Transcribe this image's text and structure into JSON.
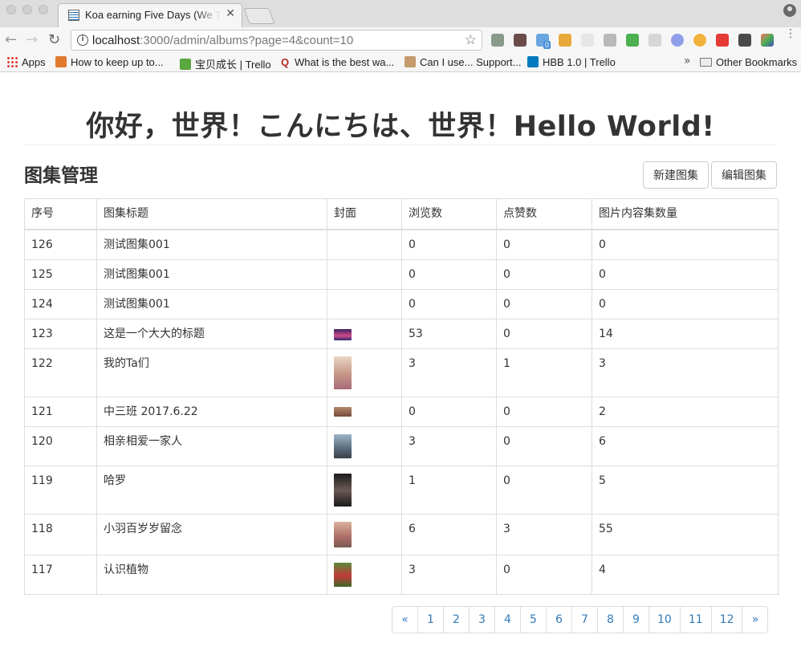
{
  "browser": {
    "tab_title": "Koa earning Five Days (We The",
    "close_glyph": "✕",
    "url_host": "localhost",
    "url_rest": ":3000/admin/albums?page=4&count=10",
    "info_glyph": "i",
    "star_glyph": "☆",
    "back_glyph": "←",
    "forward_glyph": "→",
    "reload_glyph": "↻",
    "menu_glyph": "⋮",
    "overflow_glyph": "»",
    "bookmarks": [
      {
        "label": "Apps",
        "icon": "apps-grid-icon"
      },
      {
        "label": "How to keep up to...",
        "icon": "bookmark-favicon-icon"
      },
      {
        "label": "宝贝成长 | Trello",
        "icon": "trello-board-icon"
      },
      {
        "label": "What is the best wa...",
        "icon": "quora-icon"
      },
      {
        "label": "Can I use... Support...",
        "icon": "caniuse-icon"
      },
      {
        "label": "HBB 1.0 | Trello",
        "icon": "trello-icon"
      }
    ],
    "other_bookmarks": "Other Bookmarks",
    "extension_badge": "0"
  },
  "page": {
    "hero_title": "你好，世界！こんにちは、世界！Hello World!",
    "section_title": "图集管理",
    "new_button": "新建图集",
    "edit_button": "编辑图集"
  },
  "table": {
    "columns": [
      "序号",
      "图集标题",
      "封面",
      "浏览数",
      "点赞数",
      "图片内容集数量"
    ],
    "rows": [
      {
        "id": "126",
        "title": "测试图集001",
        "cover": "",
        "views": "0",
        "likes": "0",
        "count": "0"
      },
      {
        "id": "125",
        "title": "测试图集001",
        "cover": "",
        "views": "0",
        "likes": "0",
        "count": "0"
      },
      {
        "id": "124",
        "title": "测试图集001",
        "cover": "",
        "views": "0",
        "likes": "0",
        "count": "0"
      },
      {
        "id": "123",
        "title": "这是一个大大的标题",
        "cover": "concert-stage",
        "views": "53",
        "likes": "0",
        "count": "14"
      },
      {
        "id": "122",
        "title": "我的Ta们",
        "cover": "child-portrait",
        "views": "3",
        "likes": "1",
        "count": "3"
      },
      {
        "id": "121",
        "title": "中三班 2017.6.22",
        "cover": "class-group",
        "views": "0",
        "likes": "0",
        "count": "2"
      },
      {
        "id": "120",
        "title": "相亲相爱一家人",
        "cover": "family-outdoor",
        "views": "3",
        "likes": "0",
        "count": "6"
      },
      {
        "id": "119",
        "title": "哈罗",
        "cover": "dark-portrait",
        "views": "1",
        "likes": "0",
        "count": "5"
      },
      {
        "id": "118",
        "title": "小羽百岁岁留念",
        "cover": "baby-photo",
        "views": "6",
        "likes": "3",
        "count": "55"
      },
      {
        "id": "117",
        "title": "认识植物",
        "cover": "plants",
        "views": "3",
        "likes": "0",
        "count": "4"
      }
    ]
  },
  "pagination": [
    "«",
    "1",
    "2",
    "3",
    "4",
    "5",
    "6",
    "7",
    "8",
    "9",
    "10",
    "11",
    "12",
    "»"
  ],
  "colors": {
    "link": "#337ab7",
    "border": "#dddddd",
    "text": "#333333"
  }
}
